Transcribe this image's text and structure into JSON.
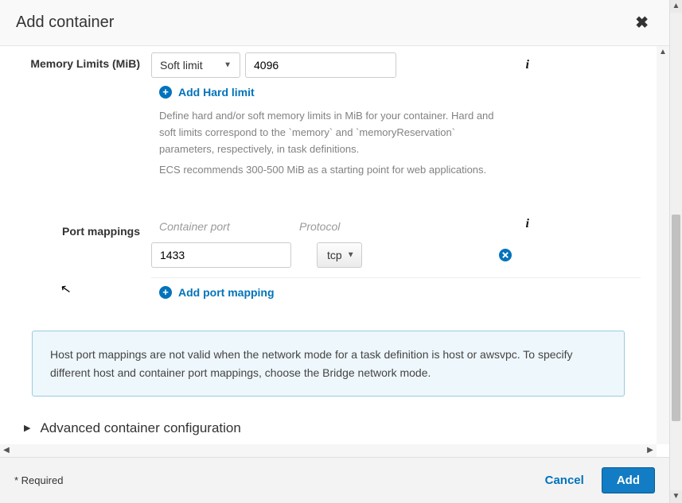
{
  "modal": {
    "title": "Add container"
  },
  "memory": {
    "label": "Memory Limits (MiB)",
    "limit_type_selected": "Soft limit",
    "value": "4096",
    "add_hard_limit": "Add Hard limit",
    "help_line1": "Define hard and/or soft memory limits in MiB for your container. Hard and soft limits correspond to the `memory` and `memoryReservation` parameters, respectively, in task definitions.",
    "help_line2": "ECS recommends 300-500 MiB as a starting point for web applications."
  },
  "ports": {
    "label": "Port mappings",
    "col_container_port": "Container port",
    "col_protocol": "Protocol",
    "rows": [
      {
        "container_port": "1433",
        "protocol": "tcp"
      }
    ],
    "add_label": "Add port mapping"
  },
  "notice": "Host port mappings are not valid when the network mode for a task definition is host or awsvpc. To specify different host and container port mappings, choose the Bridge network mode.",
  "accordion": {
    "advanced": "Advanced container configuration"
  },
  "footer": {
    "required": "* Required",
    "cancel": "Cancel",
    "add": "Add"
  }
}
